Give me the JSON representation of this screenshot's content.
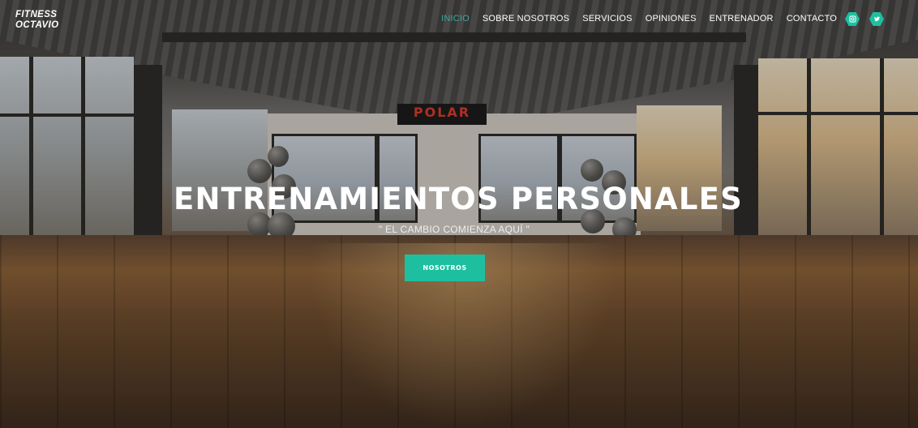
{
  "brand": {
    "line1": "FITNESS",
    "line2": "OCTAVIO"
  },
  "nav": {
    "items": [
      {
        "label": "INICIO",
        "active": true
      },
      {
        "label": "SOBRE NOSOTROS",
        "active": false
      },
      {
        "label": "SERVICIOS",
        "active": false
      },
      {
        "label": "OPINIONES",
        "active": false
      },
      {
        "label": "ENTRENADOR",
        "active": false
      },
      {
        "label": "CONTACTO",
        "active": false
      }
    ],
    "social": [
      {
        "icon": "instagram-icon"
      },
      {
        "icon": "twitter-icon"
      }
    ]
  },
  "hero": {
    "title": "ENTRENAMIENTOS PERSONALES",
    "tagline": "\" EL CAMBIO COMIENZA AQUÍ \"",
    "button_label": "NOSOTROS",
    "background_photo_text": "POLAR"
  },
  "colors": {
    "accent": "#1ebfa0",
    "active_nav": "#3fa5a0"
  }
}
